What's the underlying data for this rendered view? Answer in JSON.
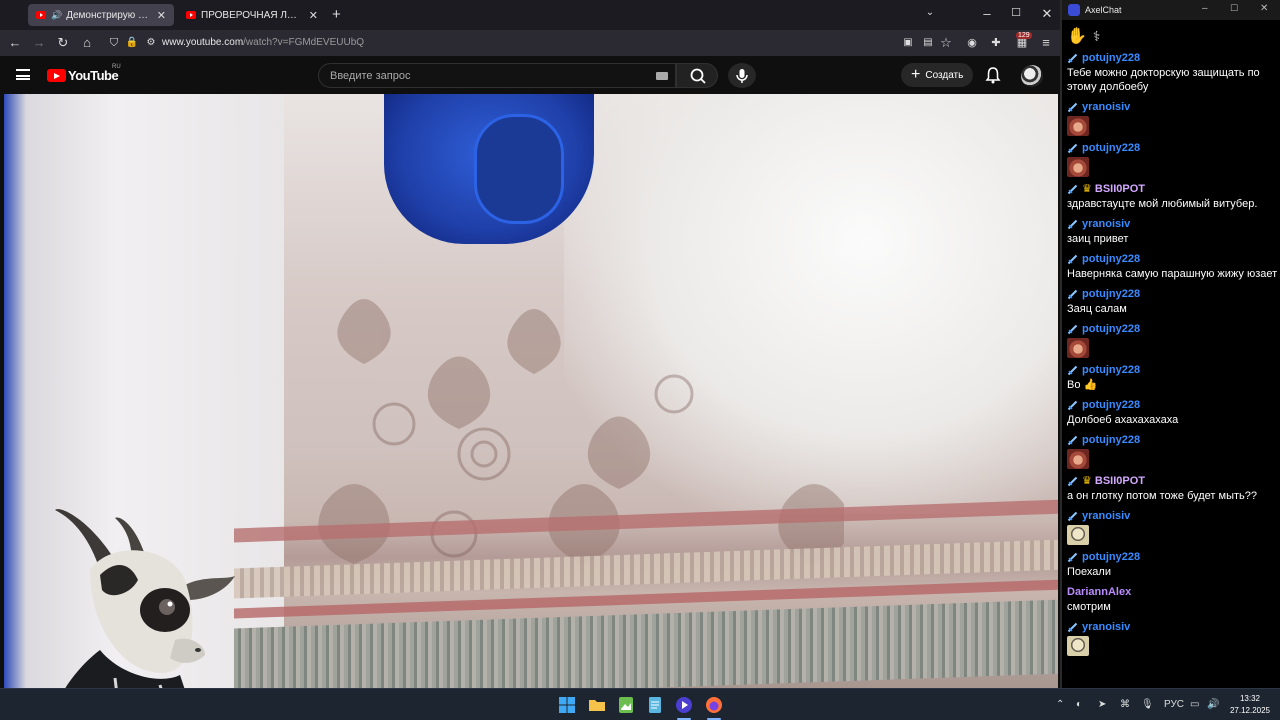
{
  "browser": {
    "tabs": [
      {
        "title": "Демонстрирую свои нові",
        "active": true,
        "audio": true
      },
      {
        "title": "ПРОВЕРОЧНАЯ ЛИНЕЙКА - М",
        "active": false,
        "audio": false
      }
    ],
    "url_prefix": "www.youtube.com",
    "url_rest": "/watch?v=FGMdEVEUUbQ",
    "extension_badge": "129"
  },
  "youtube": {
    "logo_text": "YouTube",
    "country": "RU",
    "search_placeholder": "Введите запрос",
    "create_label": "Создать"
  },
  "chat": {
    "app_title": "AxelChat",
    "messages": [
      {
        "author": "potujny228",
        "text": "Тебе можно докторскую защищать по этому долбоебу",
        "badge": "sword",
        "emote": null
      },
      {
        "author": "yranoisiv",
        "text": "",
        "badge": "sword",
        "emote": "meat"
      },
      {
        "author": "potujny228",
        "text": "",
        "badge": "sword",
        "emote": "meat"
      },
      {
        "author": "BSII0POT",
        "text": "здравстауцте мой любимый витубер.",
        "badge": "sword-crown",
        "emote": null
      },
      {
        "author": "yranoisiv",
        "text": "заиц привет",
        "badge": "sword",
        "emote": null
      },
      {
        "author": "potujny228",
        "text": "Наверняка самую парашную жижу юзает",
        "badge": "sword",
        "emote": null
      },
      {
        "author": "potujny228",
        "text": "Заяц салам",
        "badge": "sword",
        "emote": null
      },
      {
        "author": "potujny228",
        "text": "",
        "badge": "sword",
        "emote": "meat"
      },
      {
        "author": "potujny228",
        "text": "Во 👍",
        "badge": "sword",
        "emote": null
      },
      {
        "author": "potujny228",
        "text": "Долбоеб ахахахахаха",
        "badge": "sword",
        "emote": null
      },
      {
        "author": "potujny228",
        "text": "",
        "badge": "sword",
        "emote": "meat"
      },
      {
        "author": "BSII0POT",
        "text": "а он глотку потом тоже будет мыть??",
        "badge": "sword-crown",
        "emote": null
      },
      {
        "author": "yranoisiv",
        "text": "",
        "badge": "sword",
        "emote": "face"
      },
      {
        "author": "potujny228",
        "text": "Поехали",
        "badge": "sword",
        "emote": null
      },
      {
        "author": "DariannAlex",
        "text": "смотрим",
        "badge": "none",
        "emote": null
      },
      {
        "author": "yranoisiv",
        "text": "",
        "badge": "sword",
        "emote": "face"
      }
    ]
  },
  "taskbar": {
    "lang": "РУС",
    "time": "13:32",
    "date": "27.12.2025"
  },
  "colors": {
    "accent_red": "#ff0000",
    "chat_name_blue": "#3a8bff",
    "chat_name_purple": "#b98cff",
    "crown_gold": "#f5c400"
  }
}
